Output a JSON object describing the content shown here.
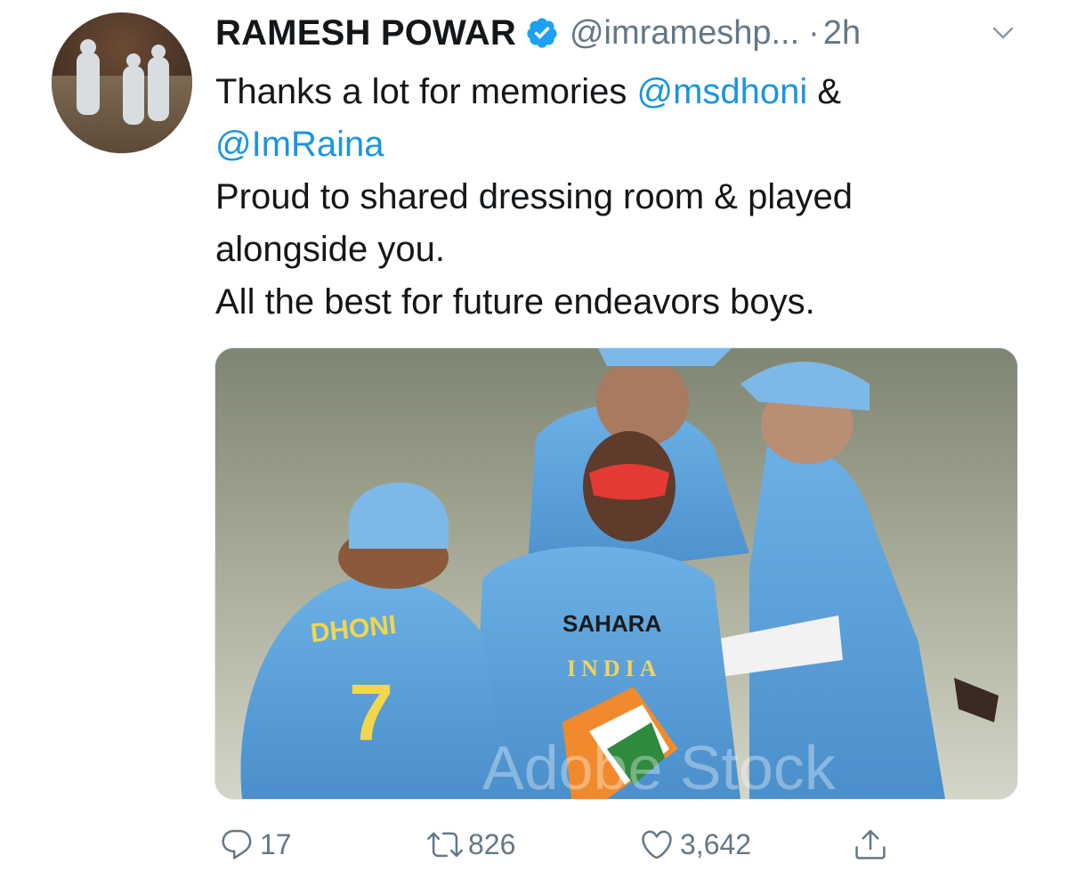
{
  "tweet": {
    "author_name": "RAMESH POWAR",
    "handle": "@imrameshp...",
    "separator": "·",
    "time": "2h",
    "text_lines": [
      {
        "text": "Thanks a lot for memories ",
        "mention": "@msdhoni",
        "after": " &"
      },
      {
        "text": "",
        "mention": "@ImRaina",
        "after": ""
      },
      {
        "text": "Proud to shared dressing room & played",
        "mention": "",
        "after": ""
      },
      {
        "text": "alongside you.",
        "mention": "",
        "after": ""
      },
      {
        "text": "All the best for future endeavors boys.",
        "mention": "",
        "after": ""
      }
    ],
    "media": {
      "jersey_name": "DHONI",
      "jersey_number": "7",
      "shirt_text_1": "SAHARA",
      "shirt_text_2": "INDIA",
      "watermark": "Adobe Stock"
    }
  },
  "actions": {
    "reply_count": "17",
    "retweet_count": "826",
    "like_count": "3,642"
  },
  "colors": {
    "link": "#1b95e0",
    "muted": "#657786",
    "text": "#14171a",
    "jersey_blue": "#5aa2dc"
  },
  "icons": [
    "verified-badge-icon",
    "chevron-down-icon",
    "reply-icon",
    "retweet-icon",
    "like-icon",
    "share-icon"
  ]
}
